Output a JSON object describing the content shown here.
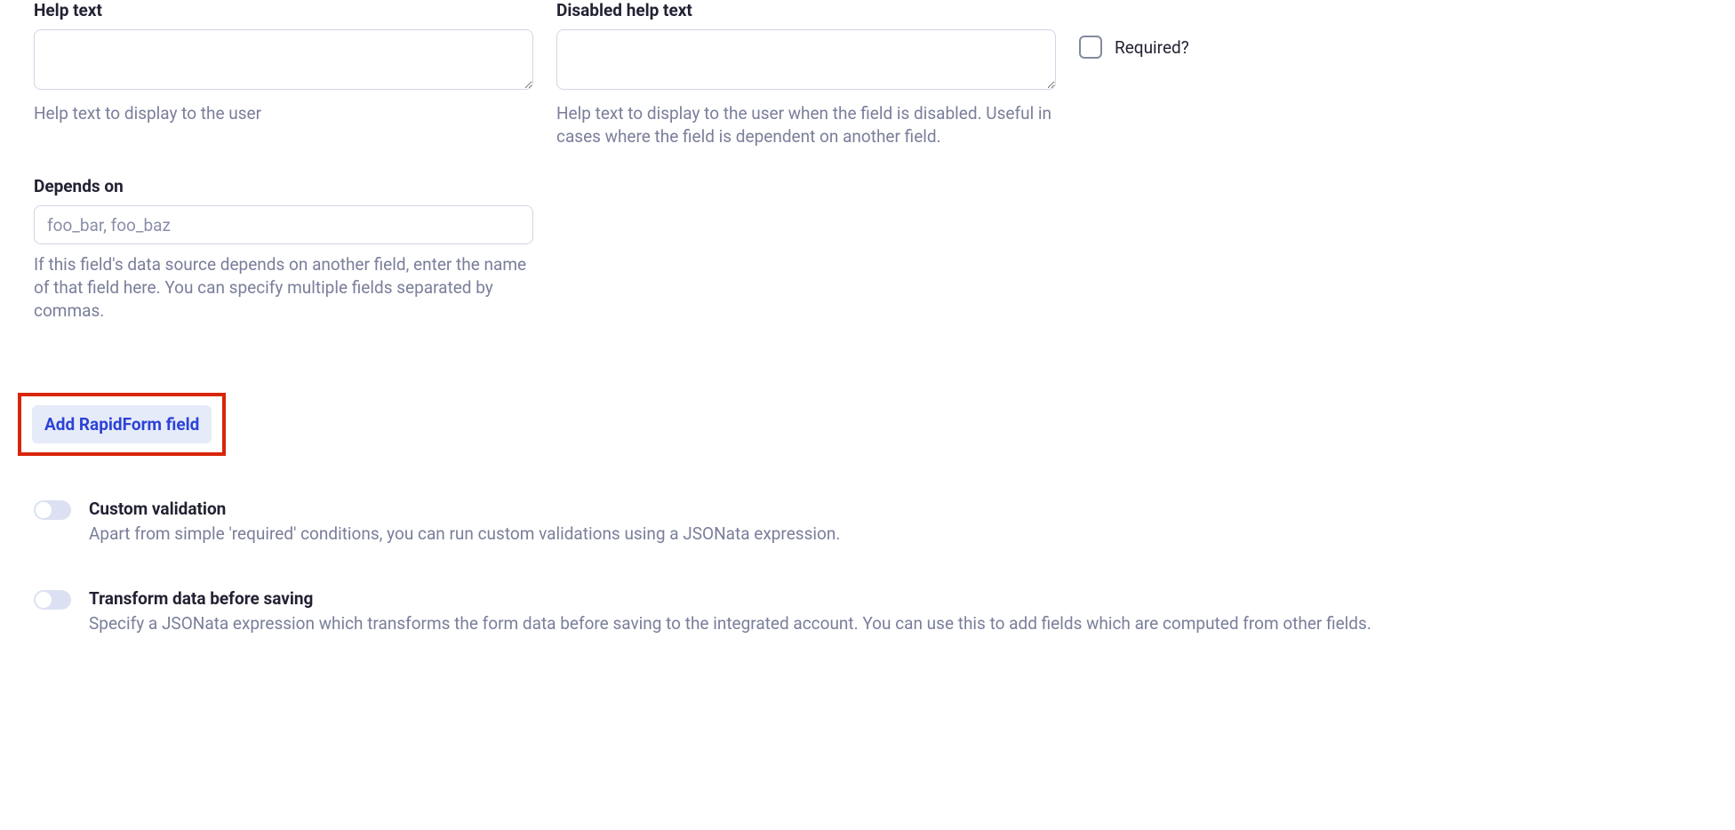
{
  "helpText": {
    "label": "Help text",
    "value": "",
    "hint": "Help text to display to the user"
  },
  "disabledHelpText": {
    "label": "Disabled help text",
    "value": "",
    "hint": "Help text to display to the user when the field is disabled. Useful in cases where the field is dependent on another field."
  },
  "required": {
    "label": "Required?"
  },
  "dependsOn": {
    "label": "Depends on",
    "placeholder": "foo_bar, foo_baz",
    "value": "",
    "hint": "If this field's data source depends on another field, enter the name of that field here. You can specify multiple fields separated by commas."
  },
  "addButton": {
    "label": "Add RapidForm field"
  },
  "customValidation": {
    "title": "Custom validation",
    "desc": "Apart from simple 'required' conditions, you can run custom validations using a JSONata expression."
  },
  "transformData": {
    "title": "Transform data before saving",
    "desc": "Specify a JSONata expression which transforms the form data before saving to the integrated account. You can use this to add fields which are computed from other fields."
  }
}
